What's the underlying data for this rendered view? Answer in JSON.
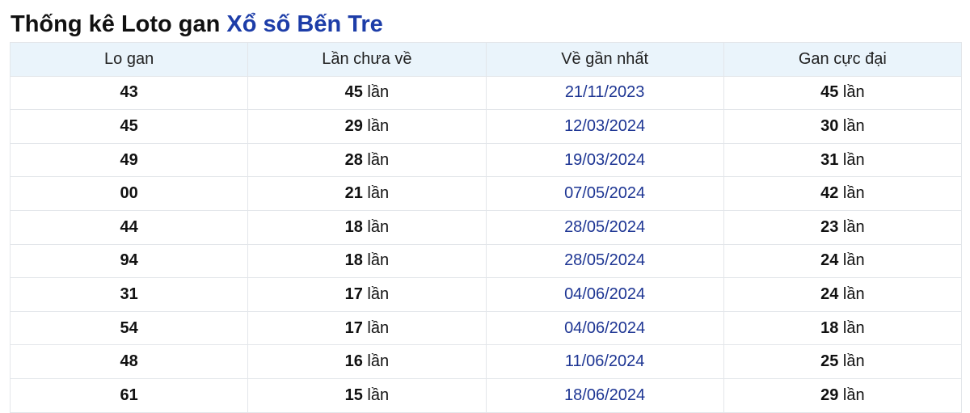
{
  "heading": {
    "prefix": "Thống kê Loto gan",
    "link": "Xổ số Bến Tre"
  },
  "table": {
    "headers": [
      "Lo gan",
      "Lần chưa về",
      "Về gần nhất",
      "Gan cực đại"
    ],
    "unit": "lần",
    "rows": [
      {
        "lo": "43",
        "missed": "45",
        "last": "21/11/2023",
        "max": "45"
      },
      {
        "lo": "45",
        "missed": "29",
        "last": "12/03/2024",
        "max": "30"
      },
      {
        "lo": "49",
        "missed": "28",
        "last": "19/03/2024",
        "max": "31"
      },
      {
        "lo": "00",
        "missed": "21",
        "last": "07/05/2024",
        "max": "42"
      },
      {
        "lo": "44",
        "missed": "18",
        "last": "28/05/2024",
        "max": "23"
      },
      {
        "lo": "94",
        "missed": "18",
        "last": "28/05/2024",
        "max": "24"
      },
      {
        "lo": "31",
        "missed": "17",
        "last": "04/06/2024",
        "max": "24"
      },
      {
        "lo": "54",
        "missed": "17",
        "last": "04/06/2024",
        "max": "18"
      },
      {
        "lo": "48",
        "missed": "16",
        "last": "11/06/2024",
        "max": "25"
      },
      {
        "lo": "61",
        "missed": "15",
        "last": "18/06/2024",
        "max": "29"
      }
    ]
  }
}
